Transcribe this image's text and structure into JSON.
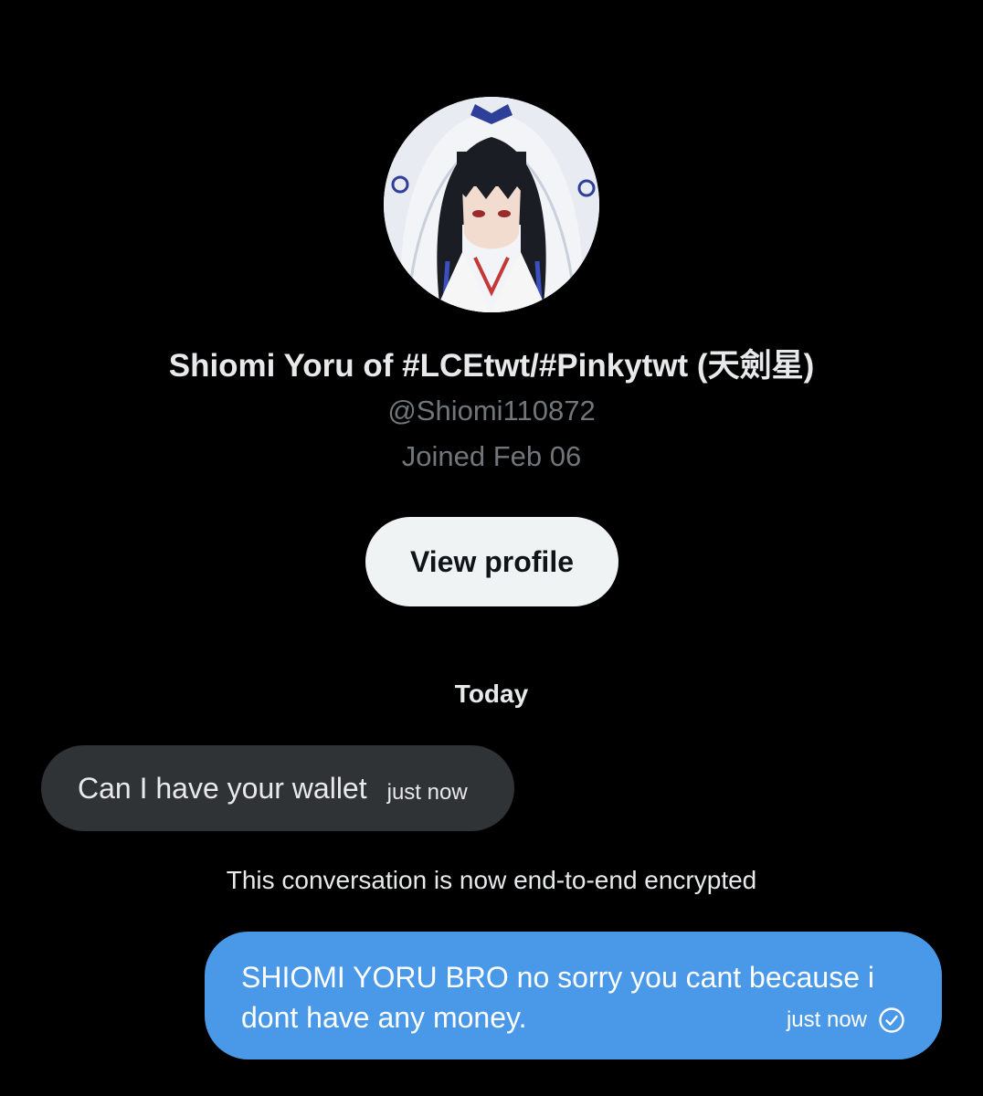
{
  "profile": {
    "display_name": "Shiomi Yoru of #LCEtwt/#Pinkytwt (天劍星)",
    "handle": "@Shiomi110872",
    "joined": "Joined Feb 06",
    "view_profile_label": "View profile",
    "avatar_icon": "avatar-image"
  },
  "conversation": {
    "day_separator": "Today",
    "messages": [
      {
        "direction": "incoming",
        "text": "Can I have your wallet",
        "time": "just now"
      },
      {
        "direction": "outgoing",
        "text": "SHIOMI YORU BRO no sorry you cant because i dont have any money.",
        "time": "just now",
        "status_icon": "check-circle-icon"
      }
    ],
    "encryption_notice": "This conversation is now end-to-end encrypted"
  },
  "colors": {
    "background": "#000000",
    "incoming_bubble": "#2f3336",
    "outgoing_bubble": "#4a99e9",
    "secondary_text": "#71767b",
    "button_bg": "#eff3f4"
  }
}
